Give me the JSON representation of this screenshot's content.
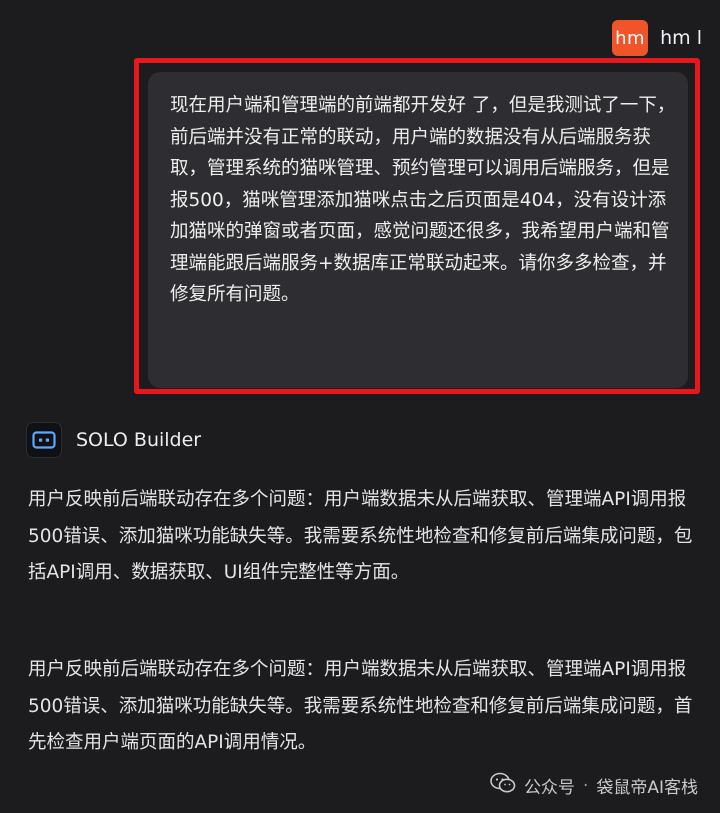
{
  "user": {
    "avatar_text": "hm",
    "name": "hm l",
    "message": "现在用户端和管理端的前端都开发好 了，但是我测试了一下，前后端并没有正常的联动，用户端的数据没有从后端服务获取，管理系统的猫咪管理、预约管理可以调用后端服务，但是报500，猫咪管理添加猫咪点击之后页面是404，没有设计添加猫咪的弹窗或者页面，感觉问题还很多，我希望用户端和管理端能跟后端服务+数据库正常联动起来。请你多多检查，并修复所有问题。"
  },
  "assistant": {
    "name": "SOLO Builder",
    "paragraphs": [
      "用户反映前后端联动存在多个问题：用户端数据未从后端获取、管理端API调用报500错误、添加猫咪功能缺失等。我需要系统性地检查和修复前后端集成问题，包括API调用、数据获取、UI组件完整性等方面。",
      "用户反映前后端联动存在多个问题：用户端数据未从后端获取、管理端API调用报500错误、添加猫咪功能缺失等。我需要系统性地检查和修复前后端集成问题，首先检查用户端页面的API调用情况。"
    ]
  },
  "watermark": {
    "platform": "公众号",
    "separator": "·",
    "account": "袋鼠帝AI客栈"
  },
  "colors": {
    "background": "#1c1c1f",
    "bubble": "#2e2e32",
    "highlight": "#e8171d",
    "avatar": "#f0552a"
  }
}
